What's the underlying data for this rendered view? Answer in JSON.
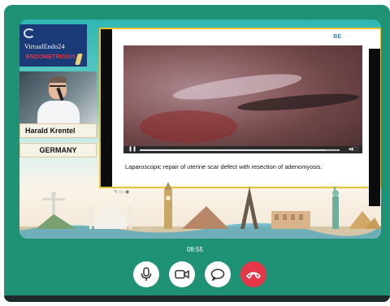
{
  "event": {
    "logo_title": "VirtualEndo24",
    "logo_subtitle": "ENDOMETRIOSIS"
  },
  "speaker": {
    "name": "Harald Krentel",
    "country": "GERMANY"
  },
  "slide": {
    "corner_text": "BE",
    "caption": "Laparoscopic repair of uterine scar defect with resection of adenomyosis.",
    "video_progress": 0.93
  },
  "call": {
    "timer": "08:55",
    "controls": {
      "mic": "microphone-icon",
      "camera": "video-camera-icon",
      "chat": "chat-icon",
      "end": "end-call-icon"
    }
  },
  "colors": {
    "frame": "#1f9275",
    "end_call": "#e4374a",
    "slide_border": "#e3c238",
    "logo_bg": "#1a3a78"
  }
}
